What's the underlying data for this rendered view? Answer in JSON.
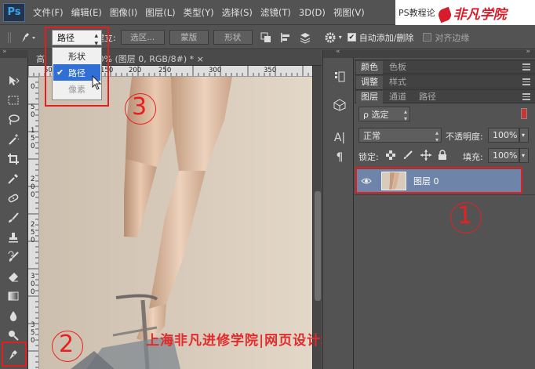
{
  "menubar": {
    "logo": "Ps",
    "items": [
      "文件(F)",
      "编辑(E)",
      "图像(I)",
      "图层(L)",
      "类型(Y)",
      "选择(S)",
      "滤镜(T)",
      "3D(D)",
      "视图(V)"
    ],
    "watermark_text": "PS教程论",
    "watermark_logo": "非凡学院"
  },
  "options": {
    "mode_selected": "路径",
    "make_label": "建立:",
    "selection_button": "选区...",
    "mask_button": "蒙版",
    "shape_button": "形状",
    "auto_add_delete_label": "自动添加/删除",
    "auto_add_delete_checked": true,
    "align_edges_label": "对齐边缘",
    "align_edges_checked": false
  },
  "mode_dropdown": {
    "items": [
      {
        "label": "形状",
        "state": "normal"
      },
      {
        "label": "路径",
        "state": "selected"
      },
      {
        "label": "像素",
        "state": "disabled"
      }
    ]
  },
  "document": {
    "tab_prefix": "高",
    "tab_title": "00% (图层 0, RGB/8#) *",
    "close": "×",
    "ruler_h_labels": [
      "50",
      "100",
      "150",
      "200",
      "250",
      "300",
      "350"
    ],
    "ruler_v_labels": [
      "0",
      "5",
      "0",
      "1",
      "5",
      "0",
      "2",
      "0",
      "0",
      "2",
      "5",
      "0",
      "3",
      "0",
      "0",
      "3",
      "5",
      "0"
    ]
  },
  "annotations": {
    "one": "1",
    "two": "2",
    "three": "3",
    "bottom_watermark": "上海非凡进修学院|网页设计培训"
  },
  "panels": {
    "row1": {
      "tabs": [
        "颜色",
        "色板"
      ]
    },
    "row2": {
      "tabs": [
        "调整",
        "样式"
      ]
    },
    "row3": {
      "tabs": [
        "图层",
        "通道",
        "路径"
      ]
    },
    "filter_label": "ρ 选定",
    "blend_mode": "正常",
    "opacity_label": "不透明度:",
    "opacity_value": "100%",
    "lock_label": "锁定:",
    "fill_label": "填充:",
    "fill_value": "100%",
    "layer_name": "图层 0"
  },
  "colors": {
    "accent_red": "#e02020",
    "dropdown_selected": "#2f6fd6",
    "layer_selected": "#6e84a8"
  }
}
